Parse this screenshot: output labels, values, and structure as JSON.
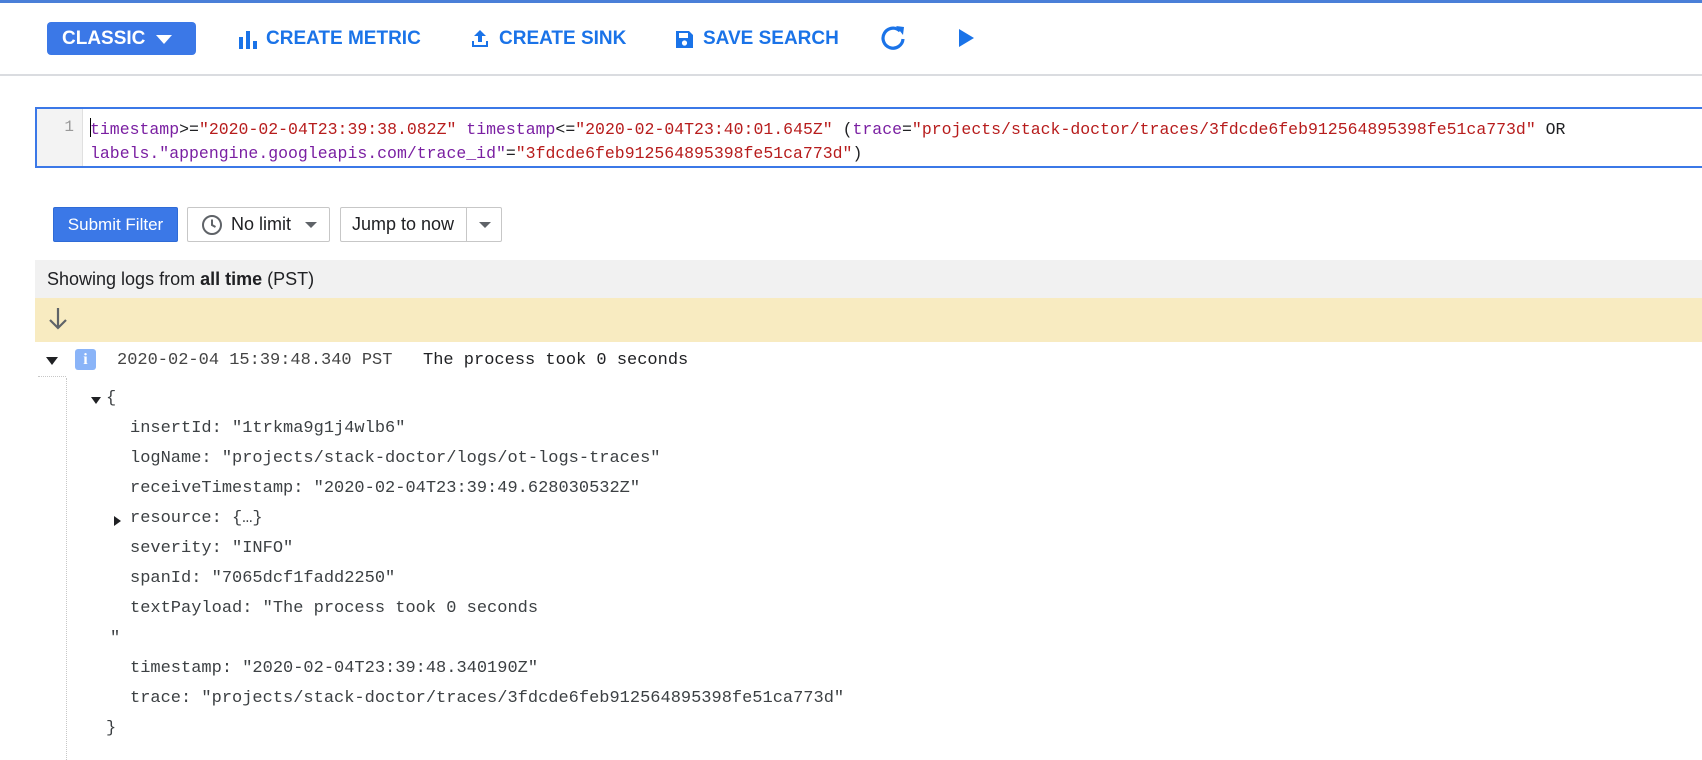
{
  "toolbar": {
    "view_mode": "CLASSIC",
    "create_metric": "CREATE METRIC",
    "create_sink": "CREATE SINK",
    "save_search": "SAVE SEARCH"
  },
  "editor": {
    "line_number": "1",
    "line1": [
      {
        "t": "timestamp",
        "c": "k"
      },
      {
        "t": ">=",
        "c": ""
      },
      {
        "t": "\"2020-02-04T23:39:38.082Z\"",
        "c": "s"
      },
      {
        "t": " ",
        "c": ""
      },
      {
        "t": "timestamp",
        "c": "k"
      },
      {
        "t": "<=",
        "c": ""
      },
      {
        "t": "\"2020-02-04T23:40:01.645Z\"",
        "c": "s"
      },
      {
        "t": " (",
        "c": ""
      },
      {
        "t": "trace",
        "c": "k"
      },
      {
        "t": "=",
        "c": ""
      },
      {
        "t": "\"projects/stack-doctor/traces/3fdcde6feb912564895398fe51ca773d\"",
        "c": "s"
      },
      {
        "t": " OR",
        "c": ""
      }
    ],
    "line2": [
      {
        "t": "labels.\"appengine.googleapis.com/trace_id\"",
        "c": "k"
      },
      {
        "t": "=",
        "c": ""
      },
      {
        "t": "\"3fdcde6feb912564895398fe51ca773d\"",
        "c": "s"
      },
      {
        "t": ")",
        "c": ""
      }
    ]
  },
  "controls": {
    "submit_filter": "Submit Filter",
    "time_limit": "No limit",
    "jump_to": "Jump to now"
  },
  "status": {
    "prefix": "Showing logs from",
    "range": "all time",
    "timezone": "(PST)"
  },
  "log_entry": {
    "severity_badge": "i",
    "timestamp": "2020-02-04 15:39:48.340 PST",
    "message": "The process took 0 seconds",
    "payload": {
      "open_brace": "{",
      "close_brace": "}",
      "insert_id": "insertId: \"1trkma9g1j4wlb6\"",
      "log_name": "logName: \"projects/stack-doctor/logs/ot-logs-traces\"",
      "receive_timestamp": "receiveTimestamp: \"2020-02-04T23:39:49.628030532Z\"",
      "resource": "resource: {…}",
      "severity": "severity: \"INFO\"",
      "span_id": "spanId: \"7065dcf1fadd2250\"",
      "text_payload": "textPayload: \"The process took 0 seconds",
      "text_payload_end": "\"",
      "timestamp": "timestamp: \"2020-02-04T23:39:48.340190Z\"",
      "trace": "trace: \"projects/stack-doctor/traces/3fdcde6feb912564895398fe51ca773d\""
    }
  },
  "colors": {
    "accent": "#3b78e7",
    "link": "#1a73e8",
    "keyword": "#7a1fa2",
    "string": "#b71c1c",
    "banner": "#f8ebc1"
  }
}
